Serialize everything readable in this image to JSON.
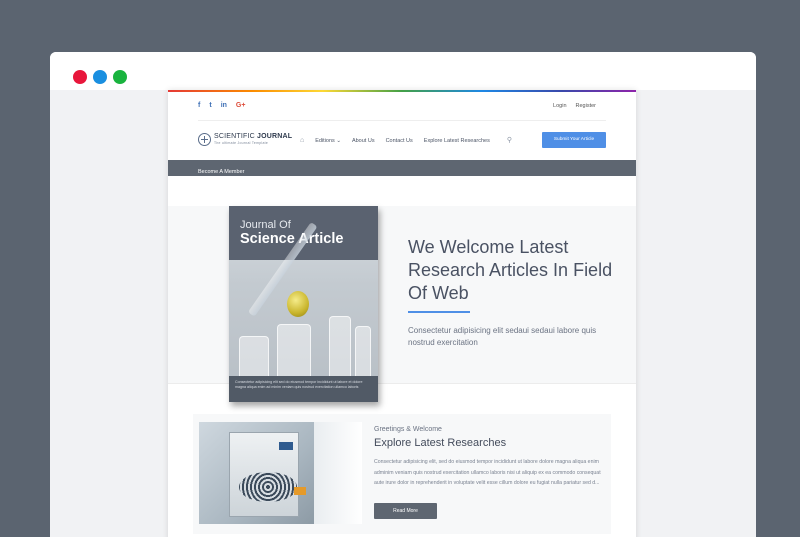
{
  "colors": {
    "background": "#5b6470",
    "accent": "#4f8fe6",
    "dark_bar": "#5e6671",
    "window_dots": [
      "#e8163b",
      "#1a8fe0",
      "#19b33e"
    ]
  },
  "topbar": {
    "social": [
      {
        "icon": "facebook-icon",
        "glyph": "f"
      },
      {
        "icon": "twitter-icon",
        "glyph": "t"
      },
      {
        "icon": "linkedin-icon",
        "glyph": "in"
      },
      {
        "icon": "google-plus-icon",
        "glyph": "G+"
      }
    ],
    "login": "Login",
    "register": "Register"
  },
  "logo": {
    "name_regular": "SCIENTIFIC ",
    "name_bold": "JOURNAL",
    "tagline": "The ultimate Journal Template"
  },
  "nav": {
    "home_icon": "home-icon",
    "items": [
      "Editions",
      "About Us",
      "Contact Us",
      "Explore Latest Researches"
    ],
    "search_icon": "search-icon",
    "submit_label": "Submit Your Article"
  },
  "member_bar": {
    "label": "Become A Member"
  },
  "hero": {
    "book": {
      "title_line1": "Journal Of",
      "title_line2": "Science Article",
      "footer_text": "Consectetur adipisicing elit sed do eiusmod tempor incididunt ut labore et dolore magna aliqua enim ad minim veniam quis nostrud exercitation ullamco laboris"
    },
    "title": "We Welcome Latest Research Articles In Field Of Web",
    "subtitle": "Consectetur adipisicing elit sedaui sedaui labore quis nostrud exercitation"
  },
  "feature": {
    "greeting": "Greetings & Welcome",
    "title": "Explore Latest Researches",
    "text": "Consectetur adipisicing elit, sed do eiusmod tempor incididunt ut labore dolore magna aliqua enim adminim veniam quis nostrud exercitation ullamco laboris nisi ut aliquip ex ea commodo consequat aute irure dolor in reprehenderit in voluptate velit esse cillum dolore eu fugiat nulla pariatur sed d...",
    "button_label": "Read More"
  }
}
